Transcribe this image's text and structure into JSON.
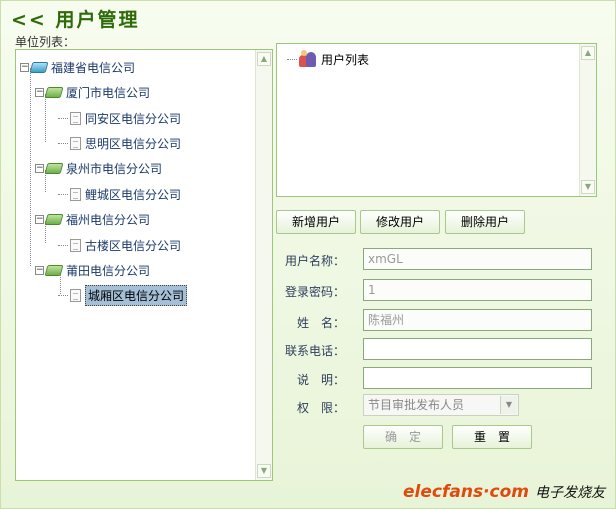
{
  "header": {
    "title": "<< 用户管理"
  },
  "tree_panel": {
    "label": "单位列表：",
    "nodes": [
      {
        "label": "福建省电信公司"
      },
      {
        "label": "厦门市电信公司"
      },
      {
        "label": "同安区电信分公司"
      },
      {
        "label": "思明区电信分公司"
      },
      {
        "label": "泉州市电信分公司"
      },
      {
        "label": "鲤城区电信分公司"
      },
      {
        "label": "福州电信分公司"
      },
      {
        "label": "古楼区电信分公司"
      },
      {
        "label": "莆田电信分公司"
      },
      {
        "label": "城厢区电信分公司"
      }
    ],
    "toggle_symbol": "−"
  },
  "user_list": {
    "root_label": "用户列表"
  },
  "actions": {
    "add": "新增用户",
    "edit": "修改用户",
    "delete": "删除用户"
  },
  "form": {
    "username_label": "用户名称：",
    "username_value": "xmGL",
    "password_label": "登录密码：",
    "password_value": "1",
    "name_label": "姓　名：",
    "name_value": "陈福州",
    "phone_label": "联系电话：",
    "phone_value": "",
    "desc_label": "说　明：",
    "desc_value": "",
    "perm_label": "权　限：",
    "perm_value": "节目审批发布人员",
    "confirm": "确　定",
    "reset": "重　置"
  },
  "scroll": {
    "up": "▲",
    "down": "▼",
    "select_arrow": "▼"
  },
  "watermark": {
    "logo": "elecfans·com",
    "cn": "电子发烧友"
  },
  "colors": {
    "accent": "#2d6a08",
    "border": "#9cc77a",
    "selection": "#a4bfd6",
    "logo": "#e04a0c"
  }
}
